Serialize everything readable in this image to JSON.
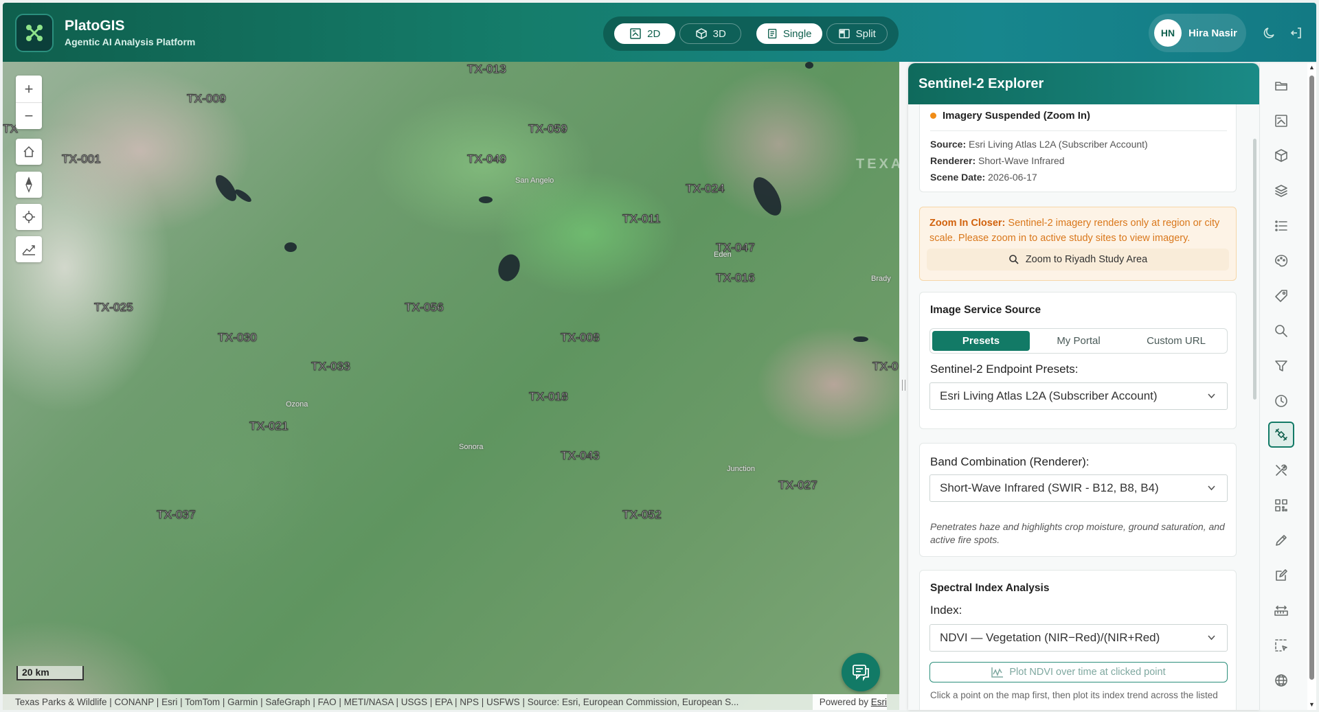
{
  "header": {
    "brand_title": "PlatoGIS",
    "brand_subtitle": "Agentic AI Analysis Platform",
    "view_modes": [
      {
        "label": "2D",
        "icon": "map-2d-icon",
        "active": true
      },
      {
        "label": "3D",
        "icon": "cube-icon",
        "active": false
      }
    ],
    "layout_modes": [
      {
        "label": "Single",
        "icon": "single-view-icon",
        "active": true
      },
      {
        "label": "Split",
        "icon": "split-view-icon",
        "active": false
      }
    ],
    "user": {
      "initials": "HN",
      "name": "Hira Nasir"
    },
    "icons": [
      "moon-icon",
      "logout-icon"
    ]
  },
  "map": {
    "site_labels": [
      "TX-013",
      "TX-009",
      "TX-059",
      "TX-049",
      "TX-001",
      "TX",
      "TX-024",
      "TX-011",
      "TX-047",
      "TX-016",
      "TX-025",
      "TX-056",
      "TX-030",
      "TX-008",
      "TX-033",
      "TX-0",
      "TX-018",
      "TX-021",
      "TX-043",
      "TX-027",
      "TX-037",
      "TX-052"
    ],
    "town_labels": [
      "San Angelo",
      "Eden",
      "Brady",
      "Ozona",
      "Sonora",
      "Junction"
    ],
    "region_label": "TEXA",
    "scale_bar": "20 km",
    "attribution": "Texas Parks & Wildlife | CONANP | Esri | TomTom | Garmin | SafeGraph | FAO | METI/NASA | USGS | EPA | NPS | USFWS | Source: Esri, European Commission, European S...",
    "powered_by": "Powered by",
    "powered_by_link": "Esri",
    "controls": [
      "zoom-in",
      "zoom-out",
      "home",
      "compass",
      "locate",
      "basemap-toggle"
    ],
    "zoom_in_label": "+",
    "zoom_out_label": "−"
  },
  "panel": {
    "title": "Sentinel-2 Explorer",
    "status": {
      "text": "Imagery Suspended (Zoom In)",
      "color": "#f08c17",
      "source_label": "Source:",
      "source_value": "Esri Living Atlas L2A (Subscriber Account)",
      "renderer_label": "Renderer:",
      "renderer_value": "Short-Wave Infrared",
      "scene_date_label": "Scene Date:",
      "scene_date_value": "2026-06-17"
    },
    "warning": {
      "bold": "Zoom In Closer:",
      "text": "Sentinel-2 imagery renders only at region or city scale. Please zoom in to active study sites to view imagery.",
      "button": "Zoom to Riyadh Study Area"
    },
    "image_service": {
      "title": "Image Service Source",
      "tabs": [
        {
          "label": "Presets",
          "active": true
        },
        {
          "label": "My Portal",
          "active": false
        },
        {
          "label": "Custom URL",
          "active": false
        }
      ],
      "presets_label": "Sentinel-2 Endpoint Presets:",
      "presets_value": "Esri Living Atlas L2A (Subscriber Account)"
    },
    "band": {
      "label": "Band Combination (Renderer):",
      "value": "Short-Wave Infrared (SWIR - B12, B8, B4)",
      "description": "Penetrates haze and highlights crop moisture, ground saturation, and active fire spots."
    },
    "spectral": {
      "title": "Spectral Index Analysis",
      "index_label": "Index:",
      "index_value": "NDVI — Vegetation (NIR−Red)/(NIR+Red)",
      "plot_button": "Plot NDVI over time at clicked point",
      "hint": "Click a point on the map first, then plot its index trend across the listed"
    }
  },
  "rail": {
    "items": [
      "folder-icon",
      "map-2d-icon",
      "cube-icon",
      "layers-icon",
      "list-icon",
      "palette-icon",
      "tag-icon",
      "search-icon",
      "filter-icon",
      "clock-icon",
      "satellite-icon",
      "tools-icon",
      "qr-icon",
      "pencil-icon",
      "edit-icon",
      "measure-icon",
      "select-icon",
      "globe-icon"
    ],
    "active_index": 10
  },
  "colors": {
    "accent": "#127a66",
    "header_gradient_start": "#0f5f4d",
    "header_gradient_end": "#137a84",
    "warning_text": "#d9771b"
  }
}
